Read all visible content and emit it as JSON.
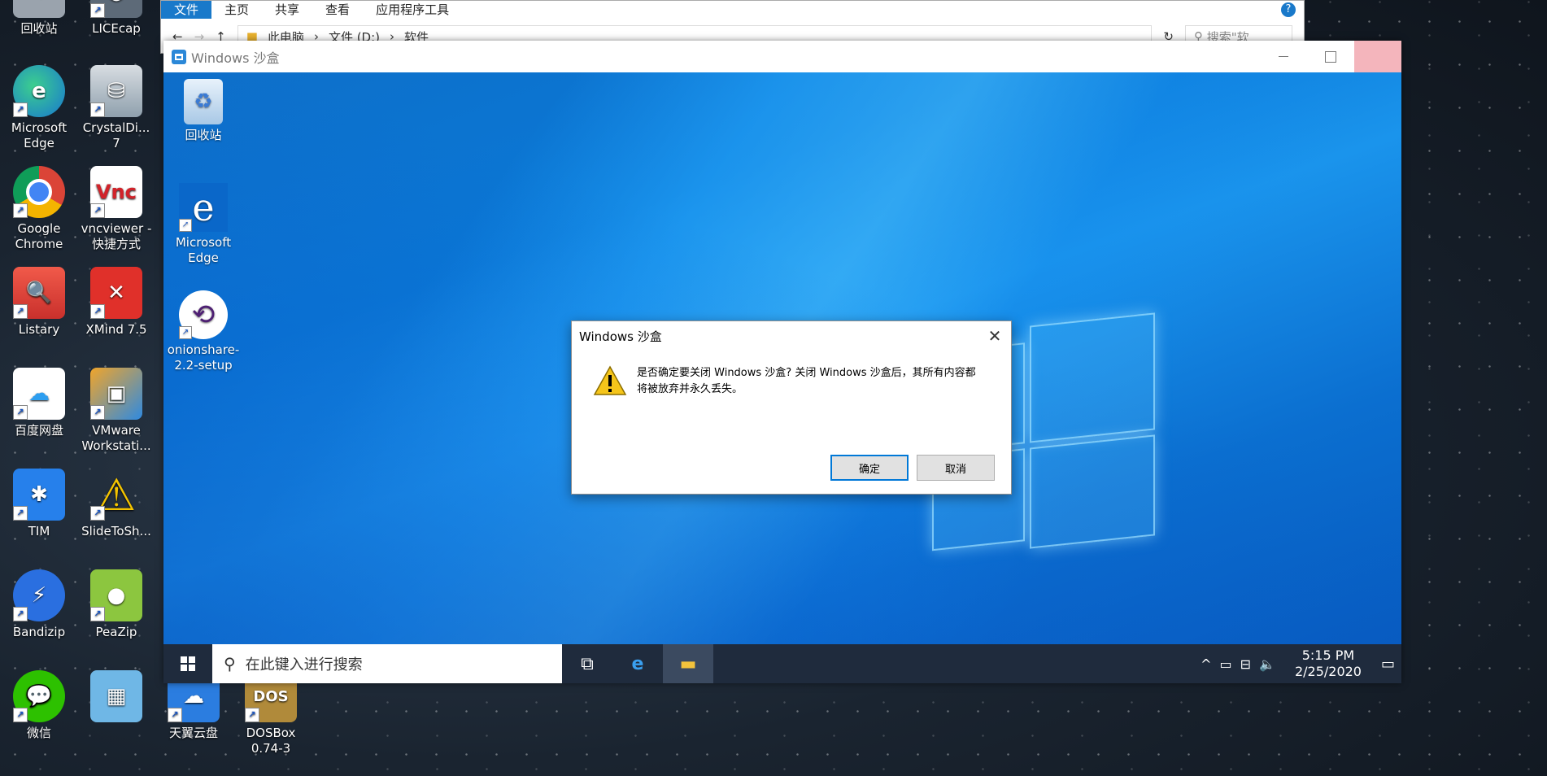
{
  "host_desktop": {
    "icons": [
      {
        "name": "recycle-bin",
        "label": "回收站",
        "color": "#9aa3ad"
      },
      {
        "name": "licecap",
        "label": "LICEcap",
        "color": "#5d6a78"
      },
      {
        "name": "edge",
        "label": "Microsoft Edge",
        "color": "#1877d0"
      },
      {
        "name": "crystaldisk",
        "label": "CrystalDi... 7",
        "color": "#3aa04a"
      },
      {
        "name": "chrome",
        "label": "Google Chrome",
        "color": "#dd4b39"
      },
      {
        "name": "vncviewer",
        "label": "vncviewer - 快捷方式",
        "color": "#ffffff"
      },
      {
        "name": "listary",
        "label": "Listary",
        "color": "#e6413a"
      },
      {
        "name": "xmind",
        "label": "XMind 7.5",
        "color": "#e0302a"
      },
      {
        "name": "baidu",
        "label": "百度网盘",
        "color": "#2d9ef0"
      },
      {
        "name": "vmware",
        "label": "VMware Workstati...",
        "color": "#f1a52a"
      },
      {
        "name": "tim",
        "label": "TIM",
        "color": "#2680eb"
      },
      {
        "name": "slidetosh",
        "label": "SlideToSh...",
        "color": "#f4c400"
      },
      {
        "name": "bandizip",
        "label": "Bandizip",
        "color": "#2a6fe0"
      },
      {
        "name": "peazip",
        "label": "PeaZip",
        "color": "#8cc63f"
      },
      {
        "name": "wechat",
        "label": "微信",
        "color": "#2dc100"
      },
      {
        "name": "unknown-app",
        "label": "",
        "color": "#6fb7e6"
      },
      {
        "name": "tianyi",
        "label": "天翼云盘",
        "color": "#2b7de0"
      },
      {
        "name": "dosbox",
        "label": "DOSBox 0.74-3",
        "color": "#b08a3a"
      }
    ]
  },
  "explorer": {
    "tabs": [
      "文件",
      "主页",
      "共享",
      "查看",
      "应用程序工具"
    ],
    "path": [
      "此电脑",
      "文件 (D:)",
      "软件"
    ],
    "search_placeholder": "搜索\"软",
    "help": "?"
  },
  "sandbox": {
    "title": "Windows 沙盒",
    "desktop_icons": [
      {
        "label": "回收站"
      },
      {
        "label": "Microsoft Edge"
      },
      {
        "label": "onionshare-2.2-setup"
      }
    ],
    "taskbar": {
      "search_placeholder": "在此键入进行搜索",
      "time": "5:15 PM",
      "date": "2/25/2020"
    }
  },
  "dialog": {
    "title": "Windows 沙盒",
    "message": "是否确定要关闭 Windows 沙盒? 关闭 Windows 沙盒后，其所有内容都将被放弃并永久丢失。",
    "ok_label": "确定",
    "cancel_label": "取消"
  },
  "colors": {
    "accent": "#0078d7",
    "taskbar": "#1f2b3d",
    "close_hover": "#f4b5bc"
  }
}
